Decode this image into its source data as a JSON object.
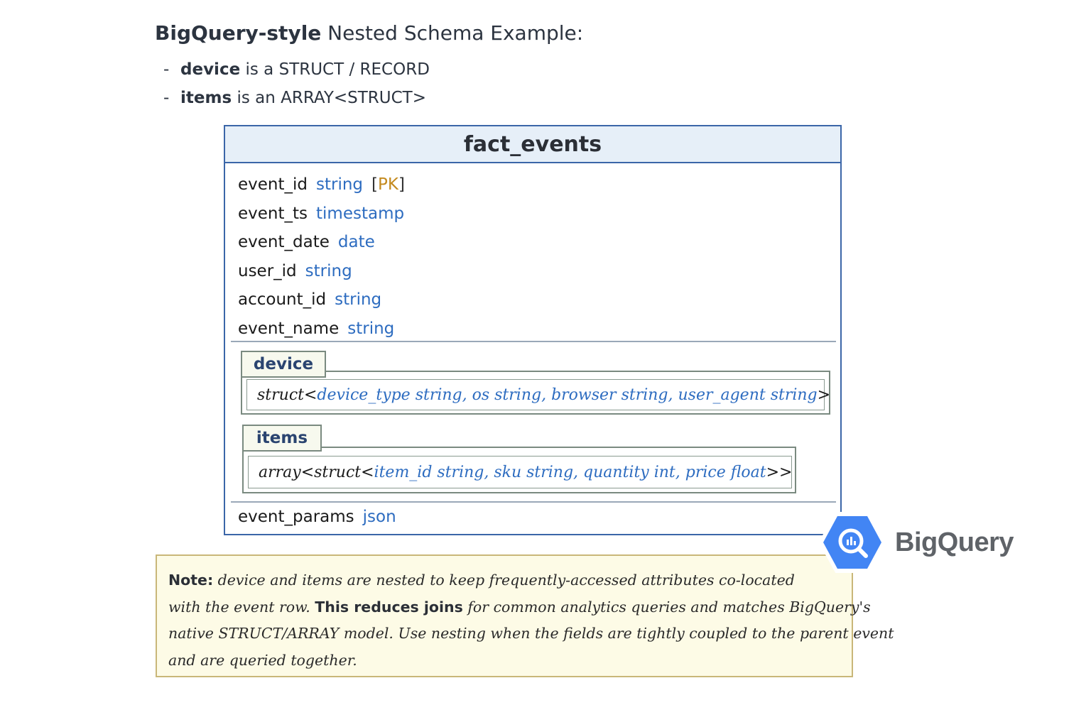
{
  "heading": {
    "bold": "BigQuery-style",
    "rest": " Nested Schema Example:"
  },
  "bullets": [
    {
      "dash": "-",
      "keyword": "device",
      "text": " is a STRUCT / RECORD"
    },
    {
      "dash": "-",
      "keyword": "items",
      "text": " is an ARRAY<STRUCT>"
    }
  ],
  "table": {
    "name": "fact_events",
    "fields": [
      {
        "name": "event_id",
        "type": "string",
        "pk_open": "[",
        "pk": "PK",
        "pk_close": "]"
      },
      {
        "name": "event_ts",
        "type": "timestamp"
      },
      {
        "name": "event_date",
        "type": "date"
      },
      {
        "name": "user_id",
        "type": "string"
      },
      {
        "name": "account_id",
        "type": "string"
      },
      {
        "name": "event_name",
        "type": "string"
      }
    ],
    "device": {
      "label": "device",
      "prefix": "struct<",
      "fields": "device_type string, os string, browser string, user_agent string",
      "suffix": ">"
    },
    "items": {
      "label": "items",
      "prefix": "array<struct<",
      "fields": "item_id string, sku string, quantity int, price float",
      "suffix": ">>"
    },
    "last_field": {
      "name": "event_params",
      "type": "json"
    }
  },
  "logo": {
    "text": "BigQuery",
    "colors": {
      "hex": "#4285f4",
      "inner": "#ffffff"
    }
  },
  "note": {
    "label": "Note:",
    "line1": " device and items are nested to keep frequently-accessed attributes co-located",
    "line2a": "with the event row. ",
    "line2b": "This reduces joins",
    "line2c": " for common analytics queries and matches BigQuery's",
    "line3": "native STRUCT/ARRAY model. Use nesting when the fields are tightly coupled to the parent event",
    "line4": "and are queried together."
  }
}
